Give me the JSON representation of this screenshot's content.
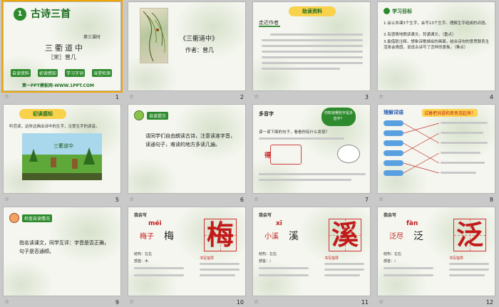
{
  "slides": [
    {
      "number": "1",
      "badge": "1",
      "title": "古诗三首",
      "lesson": "第三课时",
      "poem": "三衢道中",
      "author_line": "［宋］曾几",
      "buttons": [
        "自读资料",
        "初读感知",
        "学习字词",
        "当堂检测"
      ],
      "footer": "第一PPT模板网-WWW.1PPT.COM"
    },
    {
      "number": "2",
      "poem_title": "《三衢道中》",
      "author": "作者：曾几"
    },
    {
      "number": "3",
      "banner": "助读资料",
      "heading": "走近作者"
    },
    {
      "number": "4",
      "heading": "学习目标",
      "goals": [
        "1.会认本课3个生字，会写13个生字。理解生字组成的词语。",
        "2.有感情地朗读课文。背诵课文。（重点）",
        "3.能借助注释，想象诗歌描绘的画面，结合诗句的意思联系生活体会情感，说说古诗写了怎样的景象。（难点）"
      ]
    },
    {
      "number": "5",
      "banner": "初读感知",
      "instruction": "听范读，边听边画出诗中的生字，注意生字的读音。"
    },
    {
      "number": "6",
      "heading": "自读提示",
      "text": "请同学们自由朗读古诗，注意读准字音，读通句子，难读的地方多读几遍。"
    },
    {
      "number": "7",
      "heading": "多音字",
      "bubble": "你知道哪些字是多音字？",
      "reading": "读一读下面的句子，看看你有什么发现？"
    },
    {
      "number": "8",
      "heading": "理解词语",
      "prompt": "试着把词语和意思连起来！"
    },
    {
      "number": "9",
      "heading": "检查自读情况",
      "text": "指名读课文，同学互评：字音是否正确，句子是否通顺。"
    },
    {
      "number": "10",
      "heading": "我会写",
      "pinyin": "méi",
      "word": "梅子",
      "char": "梅",
      "struct": "左右",
      "radical": "木",
      "note": "书写指导"
    },
    {
      "number": "11",
      "heading": "我会写",
      "pinyin": "xī",
      "word": "小溪",
      "char": "溪",
      "struct": "左右",
      "radical": "氵",
      "note": "书写指导"
    },
    {
      "number": "12",
      "heading": "我会写",
      "pinyin": "fàn",
      "word": "泛尽",
      "char": "泛",
      "struct": "左右",
      "radical": "氵",
      "note": "书写指导"
    }
  ],
  "colors": {
    "accent": "#f0a500",
    "green": "#2d8a2d",
    "red": "#c21a1a"
  }
}
